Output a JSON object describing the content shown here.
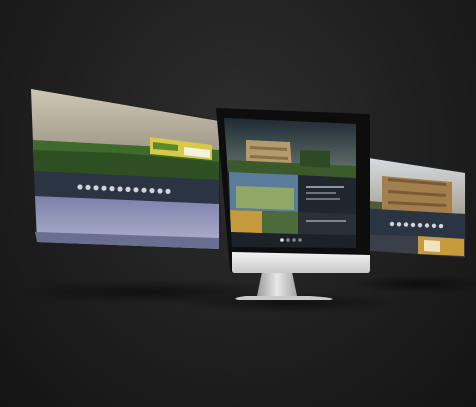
{
  "scene": {
    "description_tag": "",
    "background_color": "#1f1f1f",
    "accent_colors": {
      "sky_left": "#b9b2a4",
      "grass": "#3f6a2c",
      "nav_bar": "#2b3442",
      "lavender": "#8d8fb5",
      "yellow_banner": "#d9c94a"
    }
  },
  "left_screen": {
    "icons": [
      "dot-icon",
      "dot-icon",
      "dot-icon",
      "dot-icon",
      "dot-icon",
      "dot-icon",
      "dot-icon",
      "dot-icon",
      "dot-icon",
      "dot-icon",
      "dot-icon",
      "dot-icon"
    ]
  },
  "center_monitor": {
    "pager_dots": [
      "active",
      "inactive",
      "inactive",
      "inactive"
    ]
  },
  "right_screen": {
    "icons": [
      "dot-icon",
      "dot-icon",
      "dot-icon",
      "dot-icon",
      "dot-icon",
      "dot-icon",
      "dot-icon",
      "dot-icon"
    ]
  }
}
